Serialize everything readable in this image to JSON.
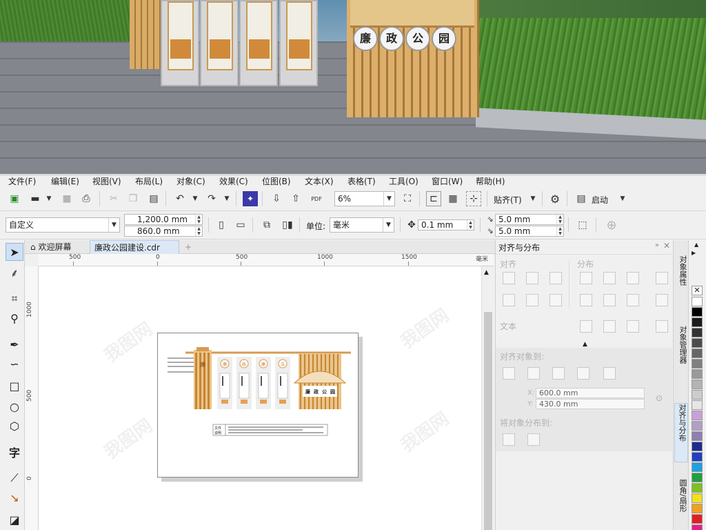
{
  "photo": {
    "sign_chars": [
      "廉",
      "政",
      "公",
      "园"
    ]
  },
  "menubar": {
    "items": [
      "文件(F)",
      "编辑(E)",
      "视图(V)",
      "布局(L)",
      "对象(C)",
      "效果(C)",
      "位图(B)",
      "文本(X)",
      "表格(T)",
      "工具(O)",
      "窗口(W)",
      "帮助(H)"
    ]
  },
  "standard_toolbar": {
    "zoom_value": "6%",
    "snap_to_label": "贴齐(T)",
    "launch_label": "启动"
  },
  "property_bar": {
    "page_preset": "自定义",
    "width_value": "1,200.0 mm",
    "height_value": "860.0 mm",
    "units_label": "单位:",
    "units_value": "毫米",
    "nudge_value": "0.1 mm",
    "dup_x": "5.0 mm",
    "dup_y": "5.0 mm"
  },
  "document_tabs": [
    {
      "label": "欢迎屏幕"
    },
    {
      "label": "廉政公园建设.cdr"
    }
  ],
  "ruler": {
    "h_ticks": [
      "500",
      "0",
      "500",
      "1000",
      "1500"
    ],
    "h_unit": "毫米",
    "v_ticks": [
      "1000",
      "500",
      "0"
    ]
  },
  "docker": {
    "title": "对齐与分布",
    "align_section": "对齐",
    "distribute_section": "分布",
    "text_section": "文本",
    "align_to_section": "对齐对象到:",
    "x_label": "X:",
    "x_value": "600.0 mm",
    "y_label": "Y:",
    "y_value": "430.0 mm",
    "distribute_to_section": "将对象分布到:"
  },
  "side_tabs": [
    "对象属性",
    "对象管理器",
    "对齐与分布",
    "圆角/扇形"
  ],
  "palette": {
    "colors": [
      "#ffffff",
      "#000000",
      "#1a1a1a",
      "#333333",
      "#4d4d4d",
      "#666666",
      "#808080",
      "#999999",
      "#b3b3b3",
      "#cccccc",
      "#e6e6e6",
      "#c8a0d8",
      "#b0a0c8",
      "#9080b0",
      "#1f2a8c",
      "#2040c0",
      "#20a0e0",
      "#20a040",
      "#80c020",
      "#f0e020",
      "#f0a020",
      "#e02020",
      "#e0208a"
    ]
  },
  "artwork": {
    "title_chars": [
      "廉",
      "政",
      "公",
      "园"
    ],
    "panel_chars": [
      "廉",
      "政",
      "廉",
      "洁"
    ],
    "footer_labels": [
      "文件",
      "说明"
    ]
  },
  "watermark": "我图网"
}
